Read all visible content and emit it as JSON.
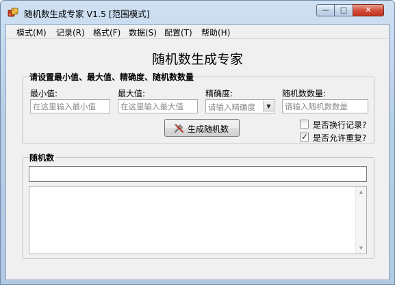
{
  "window": {
    "title": "随机数生成专家 V1.5 [范围模式]",
    "controls": {
      "minimize": "—",
      "maximize": "□",
      "close": "✕"
    }
  },
  "menu": {
    "items": [
      "模式(M)",
      "记录(R)",
      "格式(F)",
      "数据(S)",
      "配置(T)",
      "帮助(H)"
    ]
  },
  "app_title": "随机数生成专家",
  "settings": {
    "caption": "请设置最小值、最大值、精确度、随机数数量",
    "min": {
      "label": "最小值:",
      "placeholder": "在这里输入最小值",
      "value": ""
    },
    "max": {
      "label": "最大值:",
      "placeholder": "在这里输入最大值",
      "value": ""
    },
    "precision": {
      "label": "精确度:",
      "selected": "请输入精确度"
    },
    "count": {
      "label": "随机数数量:",
      "placeholder": "请输入随机数数量",
      "value": ""
    },
    "generate_button": "生成随机数",
    "newline_record": {
      "label": "是否换行记录?",
      "checked": false
    },
    "allow_repeat": {
      "label": "是否允许重复?",
      "checked": true
    }
  },
  "results": {
    "caption": "随机数",
    "current_value": "",
    "list_text": ""
  },
  "icons": {
    "app": "game-dice-icon",
    "generate": "tools-icon"
  },
  "colors": {
    "titlebar": "#b9cfe7",
    "close_button": "#c0311d",
    "client_bg": "#f0f0f0"
  }
}
